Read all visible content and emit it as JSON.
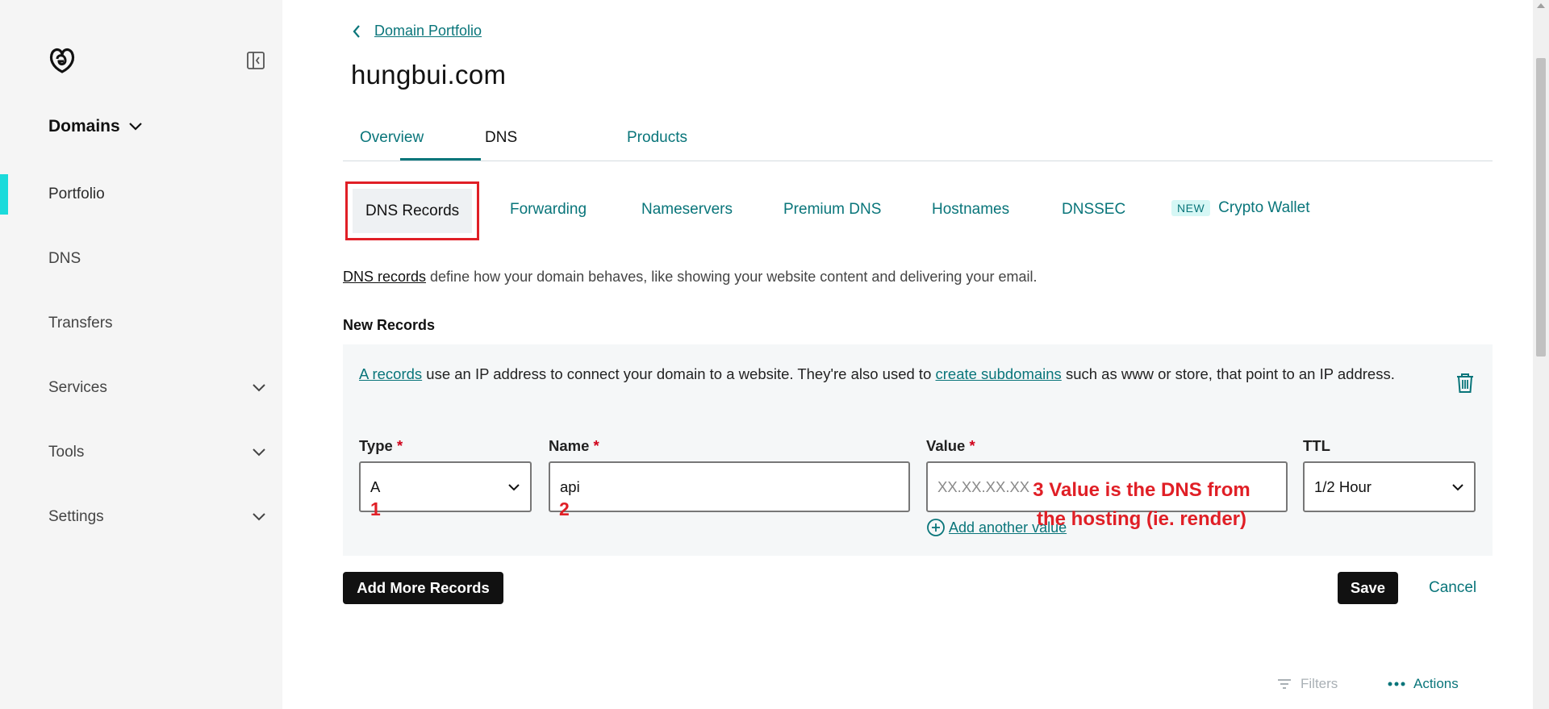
{
  "sidebar": {
    "section_title": "Domains",
    "items": [
      {
        "label": "Portfolio"
      },
      {
        "label": "DNS"
      },
      {
        "label": "Transfers"
      },
      {
        "label": "Services"
      },
      {
        "label": "Tools"
      },
      {
        "label": "Settings"
      }
    ]
  },
  "header": {
    "breadcrumb": "Domain Portfolio",
    "domain": "hungbui.com"
  },
  "tabs": [
    {
      "label": "Overview"
    },
    {
      "label": "DNS"
    },
    {
      "label": "Products"
    }
  ],
  "subtabs": [
    {
      "label": "DNS Records"
    },
    {
      "label": "Forwarding"
    },
    {
      "label": "Nameservers"
    },
    {
      "label": "Premium DNS"
    },
    {
      "label": "Hostnames"
    },
    {
      "label": "DNSSEC"
    },
    {
      "label": "Crypto Wallet",
      "badge": "NEW"
    }
  ],
  "description": {
    "link": "DNS records",
    "text": " define how your domain behaves, like showing your website content and delivering your email."
  },
  "new_records_label": "New Records",
  "record": {
    "info_link1": "A records",
    "info_text1": " use an IP address to connect your domain to a website. They're also used to ",
    "info_link2": "create subdomains",
    "info_text2": " such as www or store, that point to an IP address.",
    "type_label": "Type",
    "type_value": "A",
    "name_label": "Name",
    "name_value": "api",
    "value_label": "Value",
    "value_placeholder": "XX.XX.XX.XX",
    "ttl_label": "TTL",
    "ttl_value": "1/2 Hour",
    "required_mark": "*",
    "add_another": "Add another value"
  },
  "annotations": {
    "a1": "1",
    "a2": "2",
    "a3": "3 Value is the DNS from the hosting (ie. render)"
  },
  "buttons": {
    "add_more": "Add More Records",
    "save": "Save",
    "cancel": "Cancel"
  },
  "toolbar": {
    "filters": "Filters",
    "actions": "Actions"
  },
  "colors": {
    "accent": "#09757a",
    "active_bar": "#1bdbdb",
    "annotation": "#e01f26"
  }
}
